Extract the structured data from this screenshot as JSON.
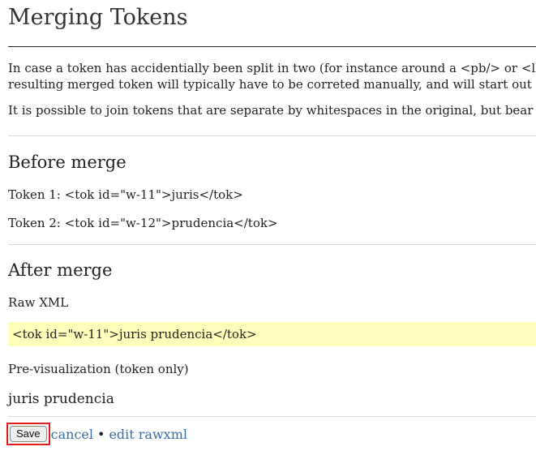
{
  "page": {
    "title": "Merging Tokens",
    "intro_line_1": "In case a token has accidentially been split in two (for instance around a <pb/> or <lb/>",
    "intro_line_2": "resulting merged token will typically have to be correted manually, and will start out by",
    "intro_line_3": "It is possible to join tokens that are separate by whitespaces in the original, but bear in n"
  },
  "before": {
    "heading": "Before merge",
    "token1_label": "Token 1:",
    "token1_xml": "<tok id=\"w-11\">juris</tok>",
    "token2_label": "Token 2:",
    "token2_xml": "<tok id=\"w-12\">prudencia</tok>"
  },
  "after": {
    "heading": "After merge",
    "raw_label": "Raw XML",
    "raw_xml": "<tok id=\"w-11\">juris prudencia</tok>",
    "preview_label": "Pre-visualization (token only)",
    "preview_text": "juris prudencia"
  },
  "actions": {
    "save_label": "Save",
    "cancel_label": "cancel",
    "separator": "•",
    "edit_raw_label": "edit rawxml"
  },
  "colors": {
    "xml_highlight": "#ffffbb",
    "link": "#3a6ea5",
    "focus_outline": "#e21b1b"
  }
}
